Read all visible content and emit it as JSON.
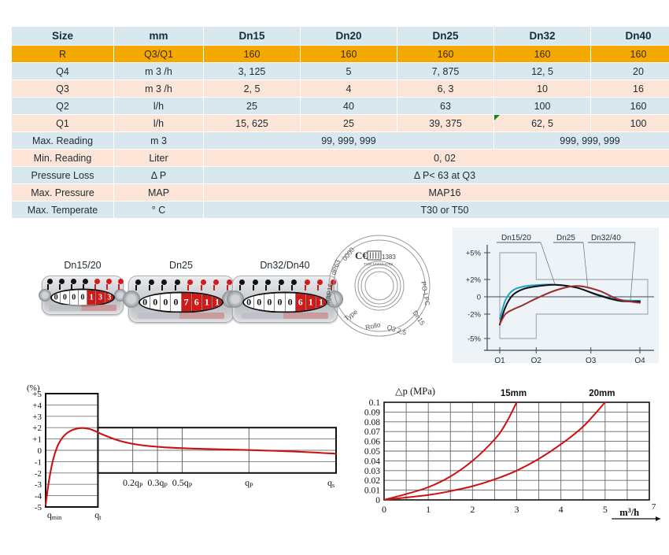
{
  "spec_table": {
    "columns": [
      "Size",
      "mm",
      "Dn15",
      "Dn20",
      "Dn25",
      "Dn32",
      "Dn40"
    ],
    "rows": [
      {
        "size": "R",
        "unit": "Q3/Q1",
        "style": "accent",
        "values": [
          "160",
          "160",
          "160",
          "160",
          "160"
        ]
      },
      {
        "size": "Q4",
        "unit": "m 3 /h",
        "style": "blue",
        "values": [
          "3, 125",
          "5",
          "7, 875",
          "12, 5",
          "20"
        ]
      },
      {
        "size": "Q3",
        "unit": "m 3 /h",
        "style": "peach",
        "values": [
          "2, 5",
          "4",
          "6, 3",
          "10",
          "16"
        ]
      },
      {
        "size": "Q2",
        "unit": "l/h",
        "style": "blue",
        "values": [
          "25",
          "40",
          "63",
          "100",
          "160"
        ]
      },
      {
        "size": "Q1",
        "unit": "l/h",
        "style": "peach",
        "values": [
          "15, 625",
          "25",
          "39, 375",
          "62, 5",
          "100"
        ],
        "flag_col": 3
      }
    ],
    "merged_rows": [
      {
        "size": "Max. Reading",
        "unit": "m 3",
        "style": "blue",
        "spans": [
          {
            "text": "99, 999, 999",
            "cols": 3
          },
          {
            "text": "999, 999, 999",
            "cols": 2
          }
        ]
      },
      {
        "size": "Min. Reading",
        "unit": "Liter",
        "style": "peach",
        "spans": [
          {
            "text": "0, 02",
            "cols": 5
          }
        ]
      },
      {
        "size": "Pressure Loss",
        "unit": "Δ P",
        "style": "blue",
        "spans": [
          {
            "text": "Δ P< 63 at Q3",
            "cols": 5
          }
        ]
      },
      {
        "size": "Max. Pressure",
        "unit": "MAP",
        "style": "peach",
        "spans": [
          {
            "text": "MAP16",
            "cols": 5
          }
        ]
      },
      {
        "size": "Max. Temperate",
        "unit": "° C",
        "style": "blue",
        "spans": [
          {
            "text": "T30 or T50",
            "cols": 5
          }
        ]
      }
    ]
  },
  "products": [
    {
      "caption": "Dn15/20",
      "digits": [
        "0",
        "0",
        "0",
        "0",
        "1",
        "3",
        "3"
      ],
      "red_from": 4
    },
    {
      "caption": "Dn25",
      "digits": [
        "0",
        "0",
        "0",
        "0",
        "7",
        "6",
        "1",
        "1"
      ],
      "red_from": 4
    },
    {
      "caption": "Dn32/Dn40",
      "digits": [
        "0",
        "0",
        "0",
        "0",
        "0",
        "6",
        "1",
        "1"
      ],
      "red_from": 5
    }
  ],
  "dial_face": {
    "ce_mark": "CE",
    "notified_body": "1383",
    "cert_code": "TCM 142/10-4759",
    "text_top_left": "0000",
    "text_left": "dP63",
    "text_left2": "MAP16",
    "text_bottom_left": "Type",
    "text_bottom": "Rollo",
    "text_bottom_right": "Q3 2,5",
    "text_right": "Dn15",
    "text_right_top": "PO-LFC"
  },
  "chart_data": [
    {
      "id": "error-curve",
      "type": "line",
      "title": "",
      "xlabel": "",
      "ylabel": "",
      "x_ticks": [
        "Q1",
        "Q2",
        "Q3",
        "Q4"
      ],
      "y_ticks": [
        "+5%",
        "+2%",
        "0",
        "-2%",
        "-5%"
      ],
      "ylim": [
        -6,
        6
      ],
      "grid": false,
      "legend_position": "top",
      "annotations": [
        "Dn15/20",
        "Dn25",
        "Dn32/40"
      ],
      "mpe_envelope": {
        "low_zone": [
          -5,
          5
        ],
        "high_zone": [
          -2,
          2
        ]
      },
      "series": [
        {
          "name": "Dn15/20",
          "color": "#1fa3c8",
          "x": [
            0,
            0.04,
            0.09,
            0.16,
            0.26,
            0.4,
            0.55,
            0.7,
            0.85,
            1.0
          ],
          "values": [
            -2.6,
            -0.4,
            0.7,
            1.15,
            1.35,
            1.4,
            1.05,
            0.25,
            -0.35,
            -0.45
          ]
        },
        {
          "name": "Dn25",
          "color": "#111111",
          "x": [
            0,
            0.04,
            0.09,
            0.16,
            0.26,
            0.4,
            0.55,
            0.7,
            0.85,
            1.0
          ],
          "values": [
            -3.3,
            -1.2,
            0.15,
            0.85,
            1.2,
            1.38,
            1.05,
            0.2,
            -0.45,
            -0.55
          ]
        },
        {
          "name": "Dn32/40",
          "color": "#9e2b2b",
          "x": [
            0,
            0.04,
            0.09,
            0.16,
            0.26,
            0.4,
            0.55,
            0.7,
            0.85,
            1.0
          ],
          "values": [
            -3.2,
            -2.0,
            -1.5,
            -1.0,
            -0.2,
            0.75,
            1.25,
            0.75,
            -0.3,
            -0.7
          ]
        }
      ]
    },
    {
      "id": "accuracy-envelope",
      "type": "line",
      "title": "",
      "ylabel": "(%)",
      "xlabel": "",
      "y_ticks": [
        "+5",
        "+4",
        "+3",
        "+2",
        "+1",
        "0",
        "-1",
        "-2",
        "-3",
        "-4",
        "-5"
      ],
      "ylim": [
        -5,
        5
      ],
      "x_ticks": [
        "qmin",
        "qt",
        "0.2qP",
        "0.3qP",
        "0.5qP",
        "qP",
        "qs"
      ],
      "grid": true,
      "mpe_envelope": {
        "low_zone": [
          -5,
          5
        ],
        "high_zone": [
          -2,
          2
        ]
      },
      "series": [
        {
          "name": "error",
          "color": "#cc1111",
          "x": [
            0.0,
            0.012,
            0.025,
            0.045,
            0.075,
            0.115,
            0.155,
            0.2,
            0.26,
            0.33,
            0.42,
            0.55,
            0.7,
            0.85,
            1.0
          ],
          "values": [
            -4.8,
            -2.6,
            -0.9,
            0.6,
            1.55,
            1.95,
            1.85,
            1.35,
            0.8,
            0.45,
            0.25,
            0.12,
            0.02,
            -0.1,
            -0.3
          ]
        }
      ]
    },
    {
      "id": "pressure-loss",
      "type": "line",
      "title": "",
      "ylabel": "△p (MPa)",
      "xlabel": "m³/h",
      "y_ticks": [
        "0.1",
        "0.09",
        "0.08",
        "0.07",
        "0.06",
        "0.05",
        "0.04",
        "0.03",
        "0.02",
        "0.01",
        "0"
      ],
      "ylim": [
        0,
        0.1
      ],
      "x_ticks": [
        "0",
        "1",
        "2",
        "3",
        "4",
        "5",
        "7"
      ],
      "xlim": [
        0,
        6
      ],
      "grid": true,
      "series": [
        {
          "name": "15mm",
          "color": "#cc1111",
          "x": [
            0.0,
            0.5,
            1.0,
            1.5,
            2.0,
            2.5,
            2.75,
            3.0
          ],
          "values": [
            0.0,
            0.006,
            0.013,
            0.024,
            0.04,
            0.062,
            0.078,
            0.1
          ]
        },
        {
          "name": "20mm",
          "color": "#cc1111",
          "x": [
            0.0,
            1.0,
            1.5,
            2.0,
            2.5,
            3.0,
            3.5,
            4.0,
            4.5,
            5.0
          ],
          "values": [
            0.0,
            0.005,
            0.009,
            0.014,
            0.021,
            0.03,
            0.042,
            0.057,
            0.075,
            0.1
          ]
        }
      ],
      "annotations": [
        "15mm",
        "20mm"
      ]
    }
  ]
}
